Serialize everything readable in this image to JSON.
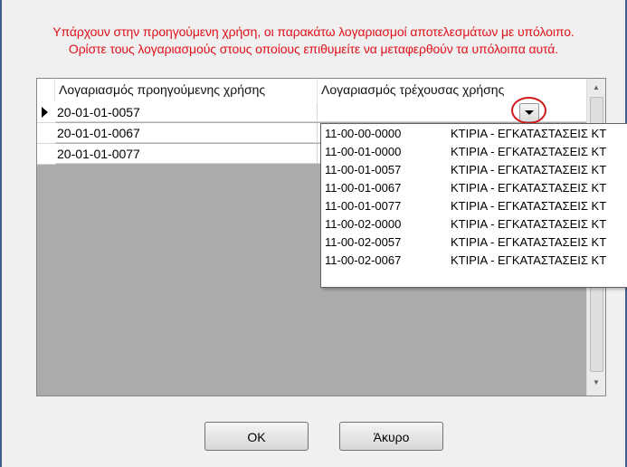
{
  "message": {
    "line1": "Υπάρχουν στην προηγούμενη χρήση, οι παρακάτω λογαριασμοί αποτελεσμάτων με υπόλοιπο.",
    "line2": "Ορίστε τους λογαριασμούς στους οποίους επιθυμείτε να μεταφερθούν τα υπόλοιπα αυτά."
  },
  "grid": {
    "columns": [
      "Λογαριασμός προηγούμενης χρήσης",
      "Λογαριασμός τρέχουσας χρήσης"
    ],
    "rows": [
      {
        "previous": "20-01-01-0057",
        "current": ""
      },
      {
        "previous": "20-01-01-0067",
        "current": ""
      },
      {
        "previous": "20-01-01-0077",
        "current": ""
      }
    ]
  },
  "dropdown": {
    "items": [
      {
        "code": "11-00-00-0000",
        "desc": "ΚΤΙΡΙΑ - ΕΓΚΑΤΑΣΤΑΣΕΙΣ ΚΤ"
      },
      {
        "code": "11-00-01-0000",
        "desc": "ΚΤΙΡΙΑ - ΕΓΚΑΤΑΣΤΑΣΕΙΣ ΚΤ"
      },
      {
        "code": "11-00-01-0057",
        "desc": "ΚΤΙΡΙΑ - ΕΓΚΑΤΑΣΤΑΣΕΙΣ ΚΤ"
      },
      {
        "code": "11-00-01-0067",
        "desc": "ΚΤΙΡΙΑ - ΕΓΚΑΤΑΣΤΑΣΕΙΣ ΚΤ"
      },
      {
        "code": "11-00-01-0077",
        "desc": "ΚΤΙΡΙΑ - ΕΓΚΑΤΑΣΤΑΣΕΙΣ ΚΤ"
      },
      {
        "code": "11-00-02-0000",
        "desc": "ΚΤΙΡΙΑ - ΕΓΚΑΤΑΣΤΑΣΕΙΣ ΚΤ"
      },
      {
        "code": "11-00-02-0057",
        "desc": "ΚΤΙΡΙΑ - ΕΓΚΑΤΑΣΤΑΣΕΙΣ ΚΤ"
      },
      {
        "code": "11-00-02-0067",
        "desc": "ΚΤΙΡΙΑ - ΕΓΚΑΤΑΣΤΑΣΕΙΣ ΚΤ"
      }
    ]
  },
  "buttons": {
    "ok": "OK",
    "cancel": "Άκυρο"
  },
  "colors": {
    "message": "#e0101a",
    "highlight_circle": "#d01818"
  }
}
